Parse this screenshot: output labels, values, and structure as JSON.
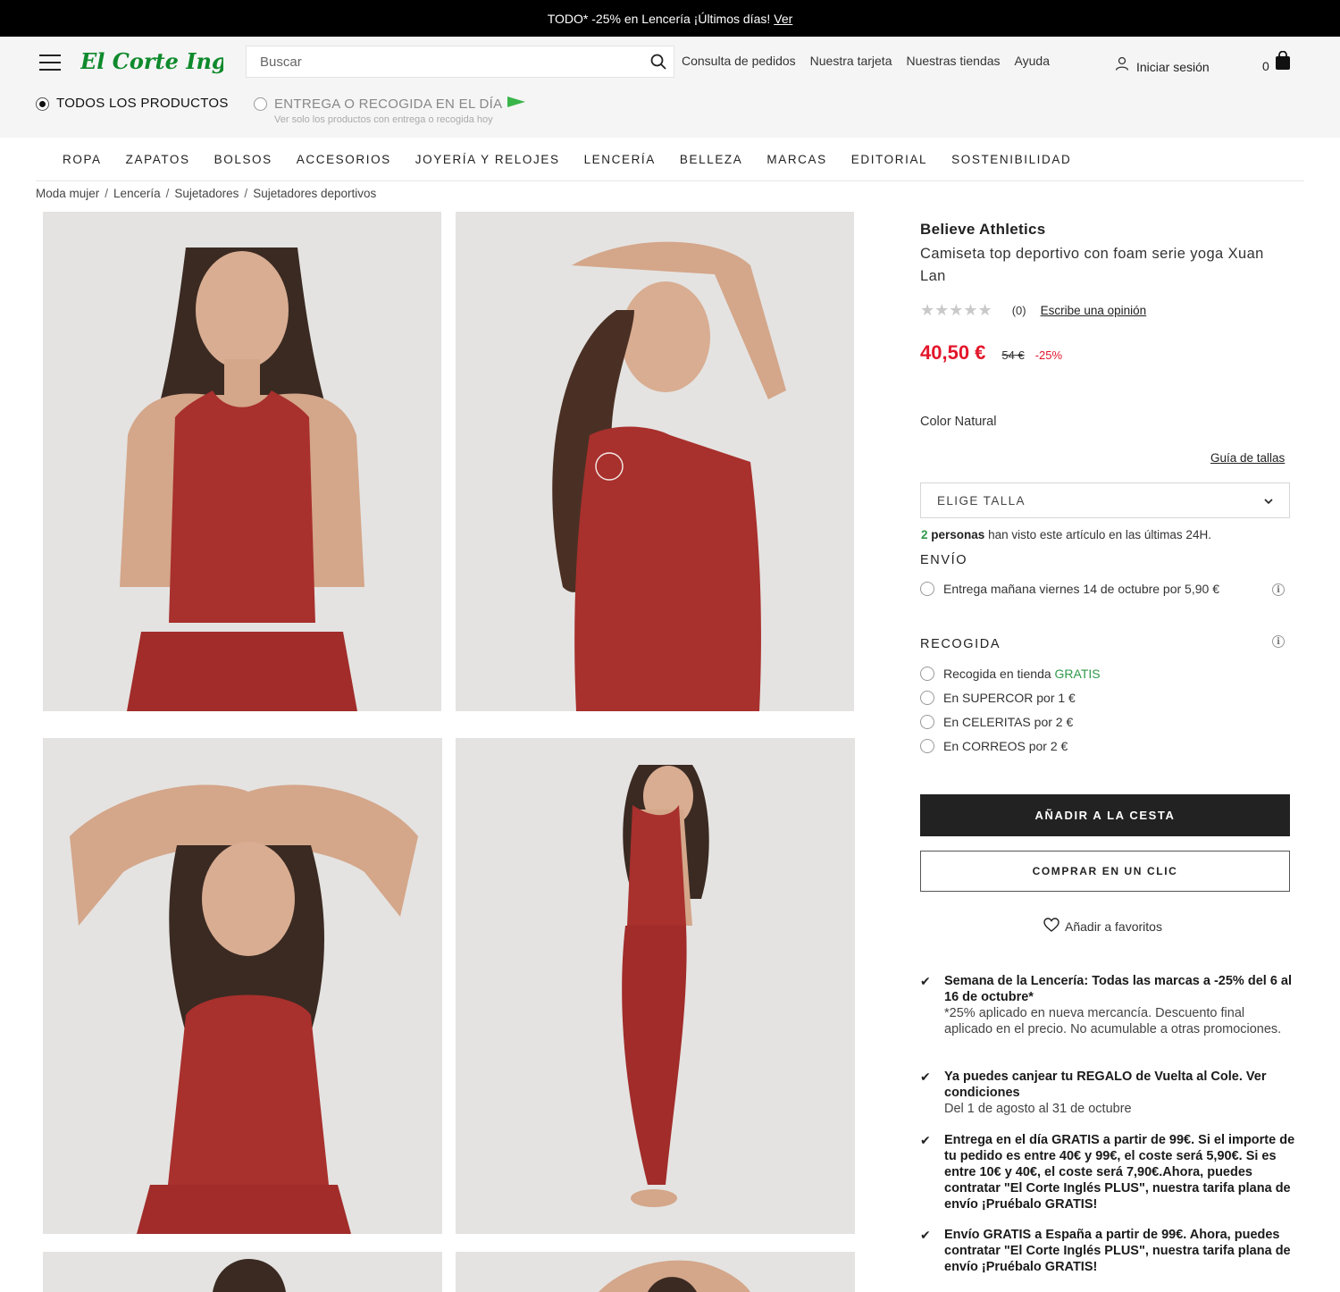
{
  "promo": {
    "text": "TODO* -25% en Lencería ¡Últimos días!",
    "link": "Ver"
  },
  "header": {
    "logo_text": "El Corte Inglés",
    "search_placeholder": "Buscar",
    "links": [
      "Consulta de pedidos",
      "Nuestra tarjeta",
      "Nuestras tiendas",
      "Ayuda"
    ],
    "login": "Iniciar sesión",
    "cart_count": "0",
    "filters": {
      "all": "TODOS LOS PRODUCTOS",
      "same_day": "ENTREGA O RECOGIDA EN EL DÍA",
      "same_day_sub": "Ver solo los productos con entrega o recogida hoy"
    }
  },
  "nav": [
    "ROPA",
    "ZAPATOS",
    "BOLSOS",
    "ACCESORIOS",
    "JOYERÍA Y RELOJES",
    "LENCERÍA",
    "BELLEZA",
    "MARCAS",
    "EDITORIAL",
    "SOSTENIBILIDAD"
  ],
  "breadcrumb": [
    "Moda mujer",
    "Lencería",
    "Sujetadores",
    "Sujetadores deportivos"
  ],
  "product": {
    "brand": "Believe Athletics",
    "title": "Camiseta top deportivo con foam serie yoga Xuan Lan",
    "stars": "★★★★★",
    "rating_count": "(0)",
    "write_review": "Escribe una opinión",
    "price": "40,50 €",
    "old_price": "54 €",
    "discount": "-25%",
    "color": "Color Natural",
    "size_guide": "Guía de tallas",
    "size_select": "ELIGE TALLA",
    "viewers_count": "2",
    "viewers_people": "personas",
    "viewers_text": "han visto este artículo en las últimas 24H."
  },
  "shipping": {
    "title": "ENVÍO",
    "option": "Entrega mañana viernes 14 de octubre por 5,90 €"
  },
  "pickup": {
    "title": "RECOGIDA",
    "store": "Recogida en tienda",
    "store_free": "GRATIS",
    "supercor": "En SUPERCOR por 1 €",
    "celeritas": "En CELERITAS por 2 €",
    "correos": "En CORREOS por 2 €"
  },
  "actions": {
    "add_to_cart": "AÑADIR A LA CESTA",
    "buy_one_click": "COMPRAR EN UN CLIC",
    "favorites": "Añadir a favoritos"
  },
  "benefits": [
    {
      "strong": "Semana de la Lencería: Todas las marcas a -25% del 6 al 16 de octubre*",
      "sub": "*25% aplicado en nueva mercancía. Descuento final aplicado en el precio. No acumulable a otras promociones."
    },
    {
      "strong": "Ya puedes canjear tu REGALO de Vuelta al Cole. Ver condiciones",
      "sub": "Del 1 de agosto al 31 de octubre"
    },
    {
      "strong": "Entrega en el día GRATIS a partir de 99€. Si el importe de tu pedido es entre 40€ y 99€, el coste será 5,90€. Si es entre 10€ y 40€, el coste será 7,90€.Ahora, puedes contratar \"El Corte Inglés PLUS\", nuestra tarifa plana de envío ¡Pruébalo GRATIS!",
      "sub": ""
    },
    {
      "strong": "Envío GRATIS a España a partir de 99€. Ahora, puedes contratar \"El Corte Inglés PLUS\", nuestra tarifa plana de envío ¡Pruébalo GRATIS!",
      "sub": ""
    }
  ],
  "colors": {
    "accent_green": "#2f9a4a",
    "price_red": "#e4162b",
    "brand_green": "#0e8a2c",
    "garment_red": "#a8302d"
  }
}
